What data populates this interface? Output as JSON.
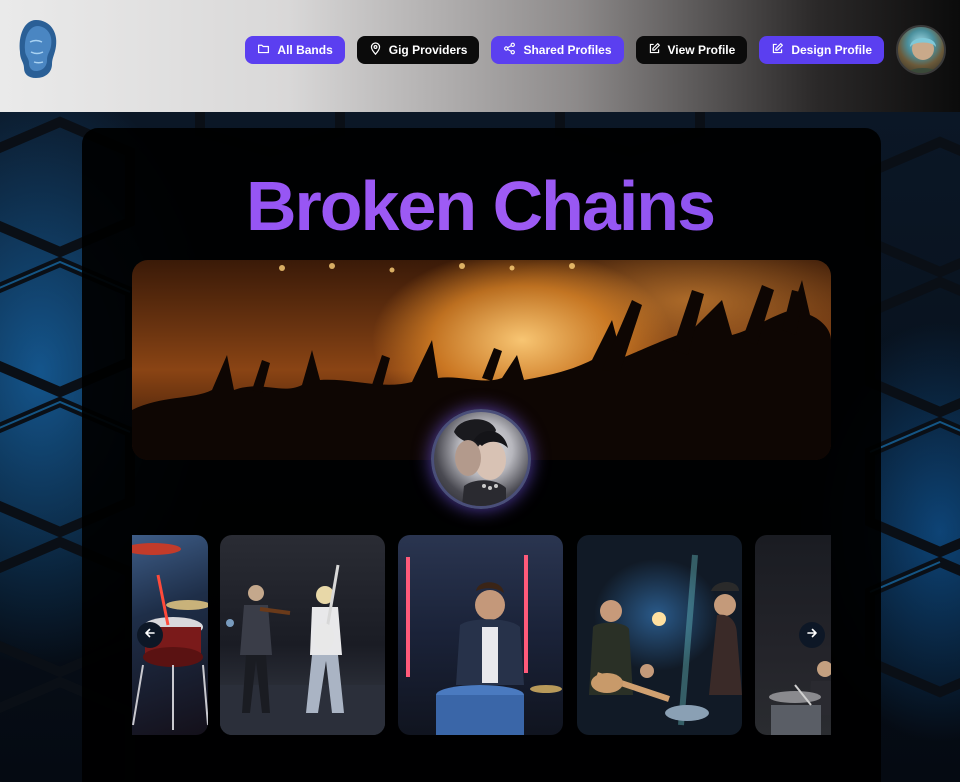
{
  "brand": {
    "logo": "head-sculpture-logo"
  },
  "nav": {
    "items": [
      {
        "label": "All Bands",
        "icon": "folder-icon",
        "style": "purple"
      },
      {
        "label": "Gig Providers",
        "icon": "map-pin-icon",
        "style": "black"
      },
      {
        "label": "Shared Profiles",
        "icon": "share-icon",
        "style": "purple"
      },
      {
        "label": "View Profile",
        "icon": "edit-icon",
        "style": "black"
      },
      {
        "label": "Design Profile",
        "icon": "edit-icon",
        "style": "purple"
      }
    ]
  },
  "user": {
    "avatar": "user-avatar"
  },
  "profile": {
    "band_name": "Broken Chains",
    "banner": "concert-crowd-banner",
    "avatar": "band-profile-avatar"
  },
  "gallery": {
    "photos": [
      "drum-kit-photo",
      "violin-guitar-duo-photo",
      "drummer-neon-photo",
      "band-stage-photo",
      "drummer-dark-photo"
    ],
    "prev_icon": "arrow-left-icon",
    "next_icon": "arrow-right-icon"
  },
  "colors": {
    "accent_purple": "#5b3ff0",
    "title_purple": "#9b59f5",
    "card_bg": "#000000",
    "header_light": "#e6e6e6"
  }
}
